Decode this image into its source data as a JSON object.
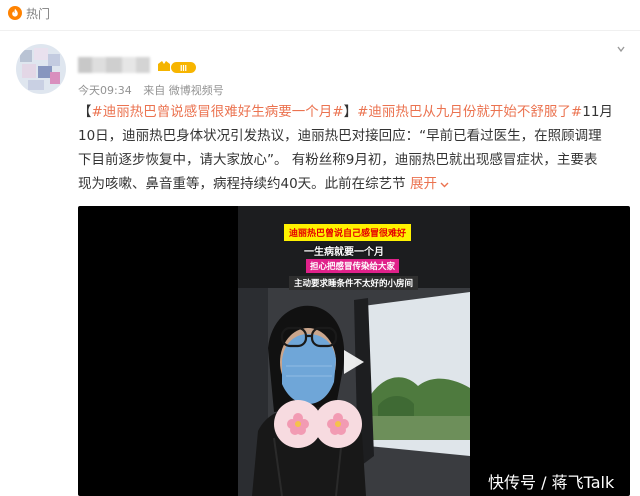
{
  "header": {
    "hot_label": "热门",
    "hot_icon": "hot-flame-icon"
  },
  "author": {
    "badge_icon": "vip-level-badge-icon",
    "time": "今天09:34",
    "source": "来自 微博视频号"
  },
  "post": {
    "lines": [
      {
        "segments": [
          {
            "text": "【",
            "kind": "text"
          },
          {
            "text": "#迪丽热巴曾说感冒很难好生病要一个月#",
            "kind": "topic"
          },
          {
            "text": "】",
            "kind": "text"
          },
          {
            "text": "#迪丽热巴从九月份就开始不舒服了#",
            "kind": "topic"
          },
          {
            "text": "11月",
            "kind": "text"
          }
        ]
      },
      {
        "segments": [
          {
            "text": "10日，迪丽热巴身体状况引发热议，迪丽热巴对接回应：“早前已看过医生，在照顾调理",
            "kind": "text"
          }
        ]
      },
      {
        "segments": [
          {
            "text": "下目前逐步恢复中，请大家放心”。 有粉丝称9月初，迪丽热巴就出现感冒症状，主要表",
            "kind": "text"
          }
        ]
      },
      {
        "segments": [
          {
            "text": "现为咳嗽、鼻音重等，病程持续约40天。此前在综艺节 ",
            "kind": "text"
          }
        ]
      }
    ],
    "expand_label": "展开",
    "expand_icon": "chevron-down-icon"
  },
  "video": {
    "captions": [
      "迪丽热巴曾说自己感冒很难好",
      "一生病就要一个月",
      "担心把感冒传染给大家",
      "主动要求睡条件不太好的小房间"
    ],
    "play_icon": "play-icon"
  },
  "watermark": "快传号 / 蒋飞Talk",
  "colors": {
    "topic": "#eb7350",
    "meta": "#939393",
    "text": "#333333",
    "caption_yellow": "#fff200",
    "caption_red": "#e60000",
    "caption_pink": "#e0218a"
  }
}
